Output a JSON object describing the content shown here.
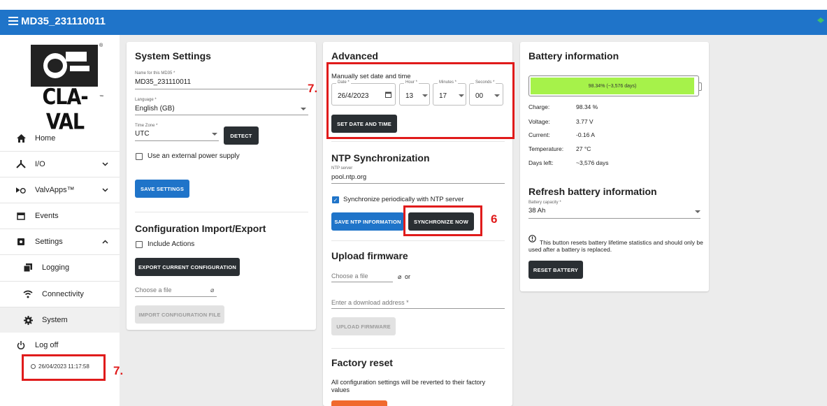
{
  "header": {
    "title": "MD35_231110011"
  },
  "logo": {
    "text": "CLA-VAL"
  },
  "sidebar": {
    "items": [
      {
        "label": "Home"
      },
      {
        "label": "I/O"
      },
      {
        "label": "ValvApps™"
      },
      {
        "label": "Events"
      },
      {
        "label": "Settings"
      },
      {
        "label": "Logging"
      },
      {
        "label": "Connectivity"
      },
      {
        "label": "System"
      },
      {
        "label": "Log off"
      }
    ],
    "datetime": "26/04/2023 11:17:58"
  },
  "system_settings": {
    "title": "System Settings",
    "name_label": "Name for this MD35 *",
    "name_value": "MD35_231110011",
    "language_label": "Language *",
    "language_value": "English (GB)",
    "timezone_label": "Time Zone *",
    "timezone_value": "UTC",
    "detect_label": "DETECT",
    "external_power_label": "Use an external power supply",
    "save_label": "SAVE SETTINGS",
    "config_title": "Configuration Import/Export",
    "include_actions_label": "Include Actions",
    "export_label": "EXPORT CURRENT CONFIGURATION",
    "choose_file_label": "Choose a file",
    "import_label": "IMPORT CONFIGURATION FILE"
  },
  "advanced": {
    "title": "Advanced",
    "manual_label": "Manually set date and time",
    "date_label": "Date *",
    "date_value": "26/4/2023",
    "hour_label": "Hour *",
    "hour_value": "13",
    "minutes_label": "Minutes *",
    "minutes_value": "17",
    "seconds_label": "Seconds *",
    "seconds_value": "00",
    "set_date_label": "SET DATE AND TIME",
    "ntp_title": "NTP Synchronization",
    "ntp_server_label": "NTP server",
    "ntp_server_value": "pool.ntp.org",
    "sync_periodic_label": "Synchronize periodically with NTP server",
    "save_ntp_label": "SAVE NTP INFORMATION",
    "sync_now_label": "SYNCHRONIZE NOW",
    "firmware_title": "Upload firmware",
    "choose_file_label": "Choose a file",
    "or_label": "or",
    "download_placeholder": "Enter a download address *",
    "upload_label": "UPLOAD FIRMWARE",
    "factory_title": "Factory reset",
    "factory_text": "All configuration settings will be reverted to their factory values"
  },
  "battery": {
    "title": "Battery information",
    "bar_text": "98.34% (~3,576 days)",
    "level_percent": 98.34,
    "stats": [
      {
        "key": "Charge:",
        "value": "98.34 %"
      },
      {
        "key": "Voltage:",
        "value": "3.77 V"
      },
      {
        "key": "Current:",
        "value": "-0.16 A"
      },
      {
        "key": "Temperature:",
        "value": "27 °C"
      },
      {
        "key": "Days left:",
        "value": "~3,576 days"
      }
    ],
    "refresh_title": "Refresh battery information",
    "capacity_label": "Battery capacity *",
    "capacity_value": "38 Ah",
    "warning_text": "This button resets battery lifetime statistics and should only be used after a battery is replaced.",
    "reset_label": "RESET BATTERY"
  },
  "annotations": {
    "label_7a": "7.",
    "label_6": "6",
    "label_7b": "7."
  },
  "colors": {
    "header_blue": "#1f74c9",
    "battery_green": "#a6f24a",
    "annotation_red": "#e01b1b",
    "dark_button": "#2a2f33"
  }
}
